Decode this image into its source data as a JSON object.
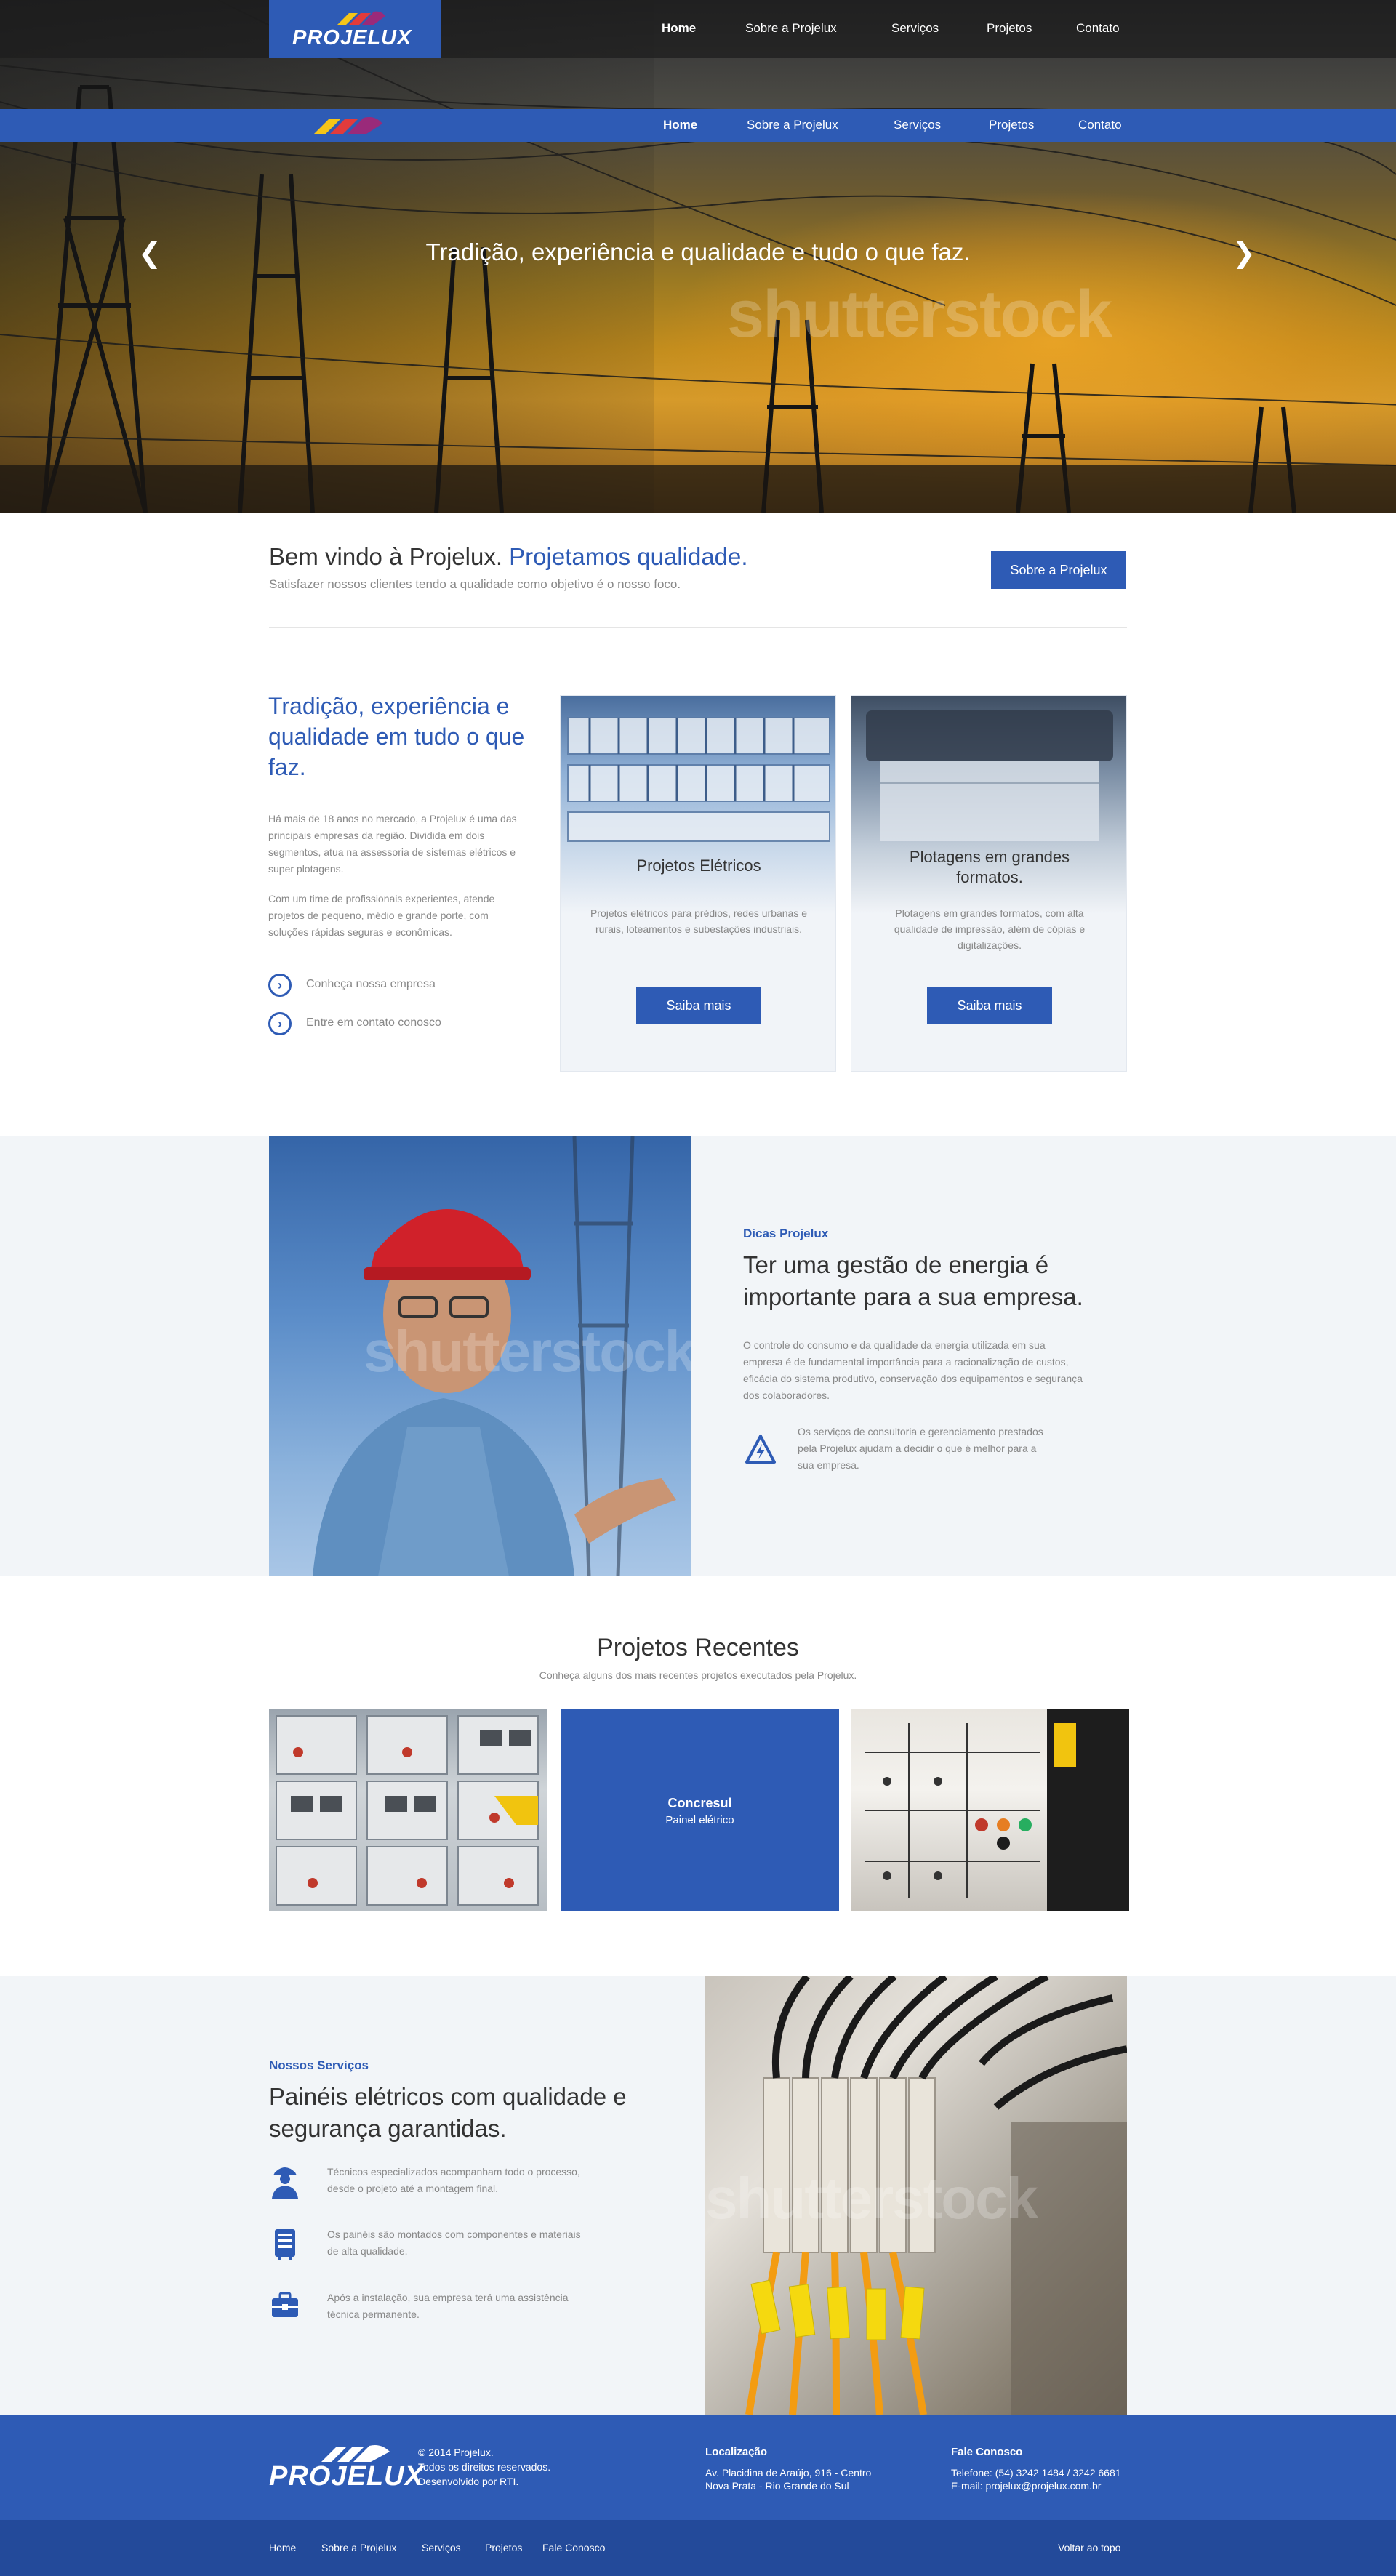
{
  "brand": {
    "name": "PROJELUX",
    "accent": "#2e5bb5",
    "dark_accent": "#234a9a"
  },
  "nav": {
    "items": [
      "Home",
      "Sobre a Projelux",
      "Serviços",
      "Projetos",
      "Contato"
    ],
    "active": "Home"
  },
  "hero": {
    "caption": "Tradição, experiência e qualidade e tudo o que faz.",
    "prev_icon": "chevron-left-icon",
    "next_icon": "chevron-right-icon",
    "watermark": "shutterstock"
  },
  "welcome": {
    "title_plain": "Bem vindo à Projelux.",
    "title_accent": "Projetamos qualidade.",
    "subtitle": "Satisfazer nossos clientes tendo a qualidade como objetivo é o nosso foco.",
    "button": "Sobre a Projelux"
  },
  "about": {
    "title": "Tradição, experiência e qualidade em tudo o que faz.",
    "paragraph1": "Há mais de 18 anos no mercado, a Projelux é uma das principais empresas da região. Dividida em dois segmentos, atua na assessoria de sistemas elétricos e super plotagens.",
    "paragraph2": "Com um time de profissionais experientes, atende projetos de pequeno, médio e grande porte, com soluções rápidas seguras e econômicas.",
    "links": [
      "Conheça nossa empresa",
      "Entre em contato conosco"
    ]
  },
  "cards": [
    {
      "title": "Projetos Elétricos",
      "description": "Projetos elétricos para prédios, redes urbanas e rurais, loteamentos e subestações industriais.",
      "button": "Saiba mais"
    },
    {
      "title": "Plotagens em grandes formatos.",
      "description": "Plotagens em grandes formatos, com alta qualidade de impressão, além de cópias e digitalizações.",
      "button": "Saiba mais"
    }
  ],
  "tips": {
    "label": "Dicas Projelux",
    "title": "Ter uma  gestão de energia é importante para a sua empresa.",
    "paragraph": "O controle do consumo e da qualidade da energia utilizada em sua empresa é de fundamental importância para a racionalização de custos, eficácia do sistema produtivo, conservação dos equipamentos e segurança dos colaboradores.",
    "highlight": "Os serviços de consultoria e gerenciamento prestados pela Projelux ajudam a decidir o que é melhor para a sua empresa.",
    "highlight_icon": "lightning-warning-icon"
  },
  "recent": {
    "title": "Projetos Recentes",
    "subtitle": "Conheça alguns dos mais recentes projetos executados pela Projelux.",
    "featured": {
      "title": "Concresul",
      "subtitle": "Painel elétrico"
    }
  },
  "services": {
    "label": "Nossos Serviços",
    "title": "Painéis elétricos com qualidade e segurança garantidas.",
    "items": [
      {
        "icon": "technician-icon",
        "text": "Técnicos especializados acompanham todo o processo, desde o projeto até a montagem final."
      },
      {
        "icon": "panel-icon",
        "text": "Os painéis são montados com componentes e materiais de alta qualidade."
      },
      {
        "icon": "toolbox-icon",
        "text": "Após a instalação, sua empresa terá uma assistência técnica permanente."
      }
    ]
  },
  "footer": {
    "copyright": [
      "© 2014 Projelux.",
      "Todos os direitos reservados.",
      "Desenvolvido por RTI."
    ],
    "location_title": "Localização",
    "location_lines": [
      "Av. Placidina de Araújo, 916 - Centro",
      "Nova Prata - Rio Grande do Sul"
    ],
    "contact_title": "Fale Conosco",
    "contact_lines": [
      "Telefone: (54) 3242 1484 / 3242 6681",
      "E-mail: projelux@projelux.com.br"
    ],
    "links": [
      "Home",
      "Sobre a Projelux",
      "Serviços",
      "Projetos",
      "Fale Conosco"
    ],
    "back_to_top": "Voltar ao topo"
  }
}
